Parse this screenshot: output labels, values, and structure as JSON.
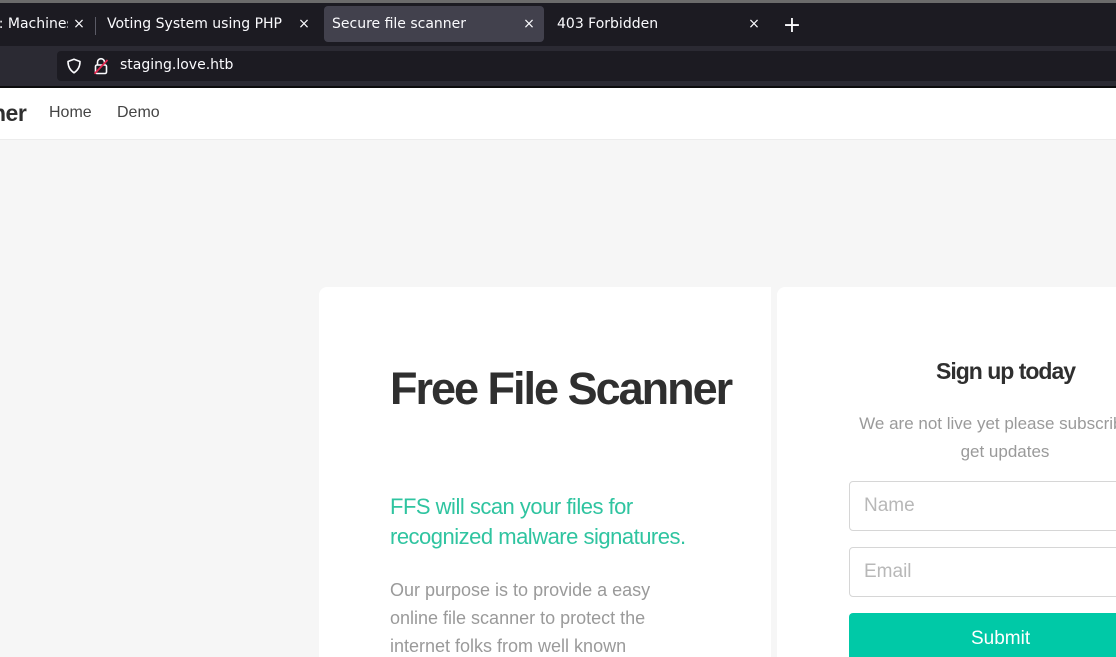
{
  "browser": {
    "tabs": [
      {
        "label": ":: Machines",
        "active": false
      },
      {
        "label": "Voting System using PHP",
        "active": false
      },
      {
        "label": "Secure file scanner",
        "active": true
      },
      {
        "label": "403 Forbidden",
        "active": false
      }
    ],
    "new_tab_symbol": "+",
    "close_symbol": "×",
    "url": "staging.love.htb"
  },
  "site": {
    "brand": "Free File Scanner",
    "brand_visible": "ner",
    "nav": [
      "Home",
      "Demo"
    ]
  },
  "hero": {
    "title": "Free File Scanner",
    "subtitle": "FFS will scan your files for recognized malware signatures.",
    "text": "Our purpose is to provide a easy online file scanner to protect the internet folks from well known"
  },
  "signup": {
    "title": "Sign up today",
    "description": "We are not live yet please subscribe to get updates",
    "name_placeholder": "Name",
    "email_placeholder": "Email",
    "submit_label": "Submit"
  },
  "colors": {
    "accent": "#00c9a7",
    "subtitle": "#2fc4a0",
    "tab_active": "#42414d",
    "tabbar": "#1c1b22"
  }
}
